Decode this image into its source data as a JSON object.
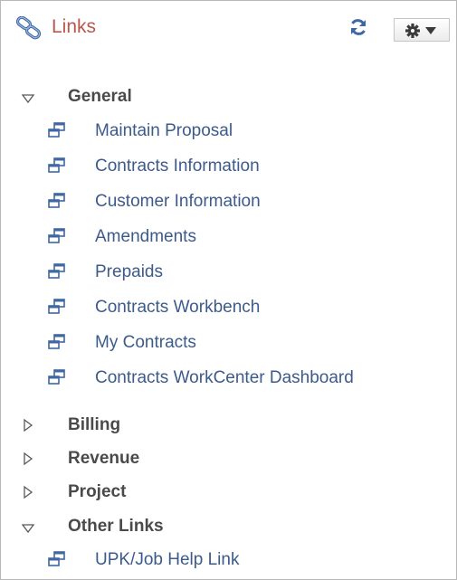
{
  "header": {
    "title": "Links",
    "title_icon": "chain-link-icon",
    "refresh_icon": "refresh-icon",
    "settings_icon": "gear-dropdown-icon"
  },
  "sections": [
    {
      "label": "General",
      "expanded": true,
      "links": [
        "Maintain Proposal",
        "Contracts Information",
        "Customer Information",
        "Amendments",
        "Prepaids",
        "Contracts Workbench",
        "My Contracts",
        "Contracts WorkCenter Dashboard"
      ]
    },
    {
      "label": "Billing",
      "expanded": false,
      "links": []
    },
    {
      "label": "Revenue",
      "expanded": false,
      "links": []
    },
    {
      "label": "Project",
      "expanded": false,
      "links": []
    },
    {
      "label": "Other Links",
      "expanded": true,
      "links": [
        "UPK/Job Help Link"
      ]
    }
  ],
  "colors": {
    "title": "#b8584c",
    "link": "#3c5b8a",
    "section": "#4a4a4a",
    "border": "#b8b8b8"
  }
}
